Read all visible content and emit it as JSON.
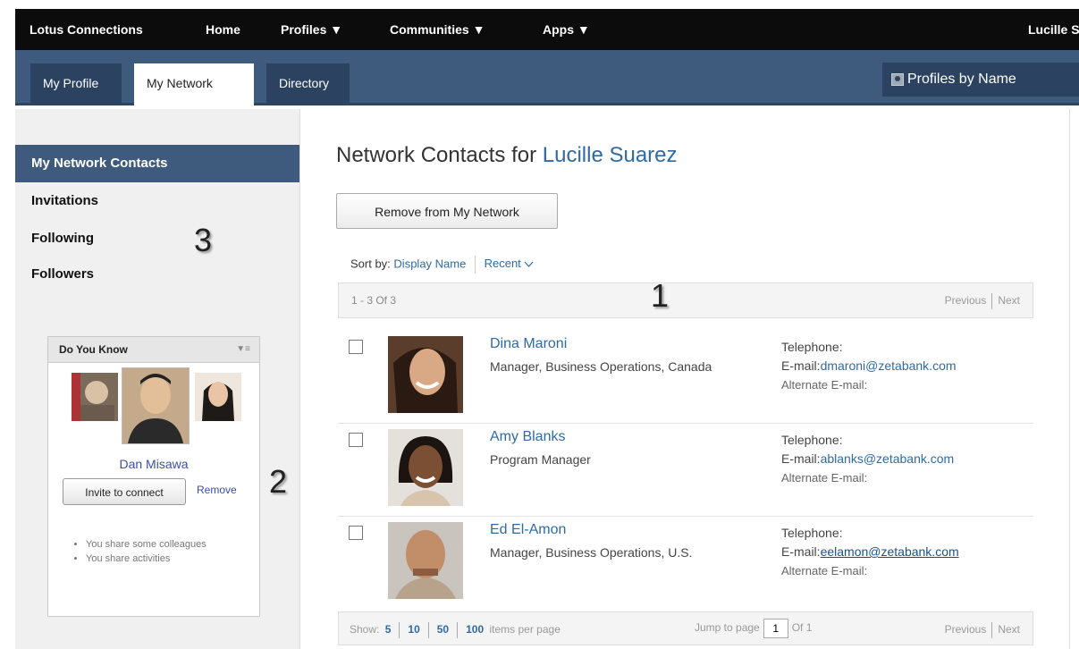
{
  "topnav": {
    "brand": "Lotus Connections",
    "home": "Home",
    "profiles": "Profiles ▼",
    "communities": "Communities ▼",
    "apps": "Apps ▼",
    "user": "Lucille S"
  },
  "tabs": {
    "my_profile": "My Profile",
    "my_network": "My Network",
    "directory": "Directory",
    "search_scope": "Profiles by Name"
  },
  "sidebar": {
    "active": "My Network Contacts",
    "items": [
      "Invitations",
      "Following",
      "Followers"
    ],
    "callout_3": "3",
    "callout_2": "2"
  },
  "do_you_know": {
    "title": "Do You Know",
    "menu": "▼≡",
    "person": "Dan Misawa",
    "invite": "Invite to connect",
    "remove": "Remove",
    "reasons": [
      "You share some colleagues",
      "You share activities"
    ]
  },
  "main": {
    "title_prefix": "Network Contacts for ",
    "title_name": "Lucille Suarez",
    "remove_button": "Remove from My Network",
    "sort_label": "Sort by:",
    "sort_display_name": "Display Name",
    "sort_recent": "Recent",
    "count": "1 - 3 Of 3",
    "callout_1": "1",
    "previous": "Previous",
    "next": "Next"
  },
  "contacts": [
    {
      "name": "Dina Maroni",
      "title": "Manager, Business Operations, Canada",
      "tel_label": "Telephone:",
      "email_label": "E-mail:",
      "email": "dmaroni@zetabank.com",
      "alt_label": "Alternate E-mail:"
    },
    {
      "name": "Amy Blanks",
      "title": "Program Manager",
      "tel_label": "Telephone:",
      "email_label": "E-mail:",
      "email": "ablanks@zetabank.com",
      "alt_label": "Alternate E-mail:"
    },
    {
      "name": "Ed El-Amon",
      "title": "Manager, Business Operations, U.S.",
      "tel_label": "Telephone:",
      "email_label": "E-mail:",
      "email": "eelamon@zetabank.com",
      "alt_label": "Alternate E-mail:"
    }
  ],
  "footer": {
    "show": "Show:",
    "sizes": [
      "5",
      "10",
      "50",
      "100"
    ],
    "per_page": "items per page",
    "jump": "Jump to page",
    "page_value": "1",
    "of": "Of 1",
    "previous": "Previous",
    "next": "Next"
  }
}
